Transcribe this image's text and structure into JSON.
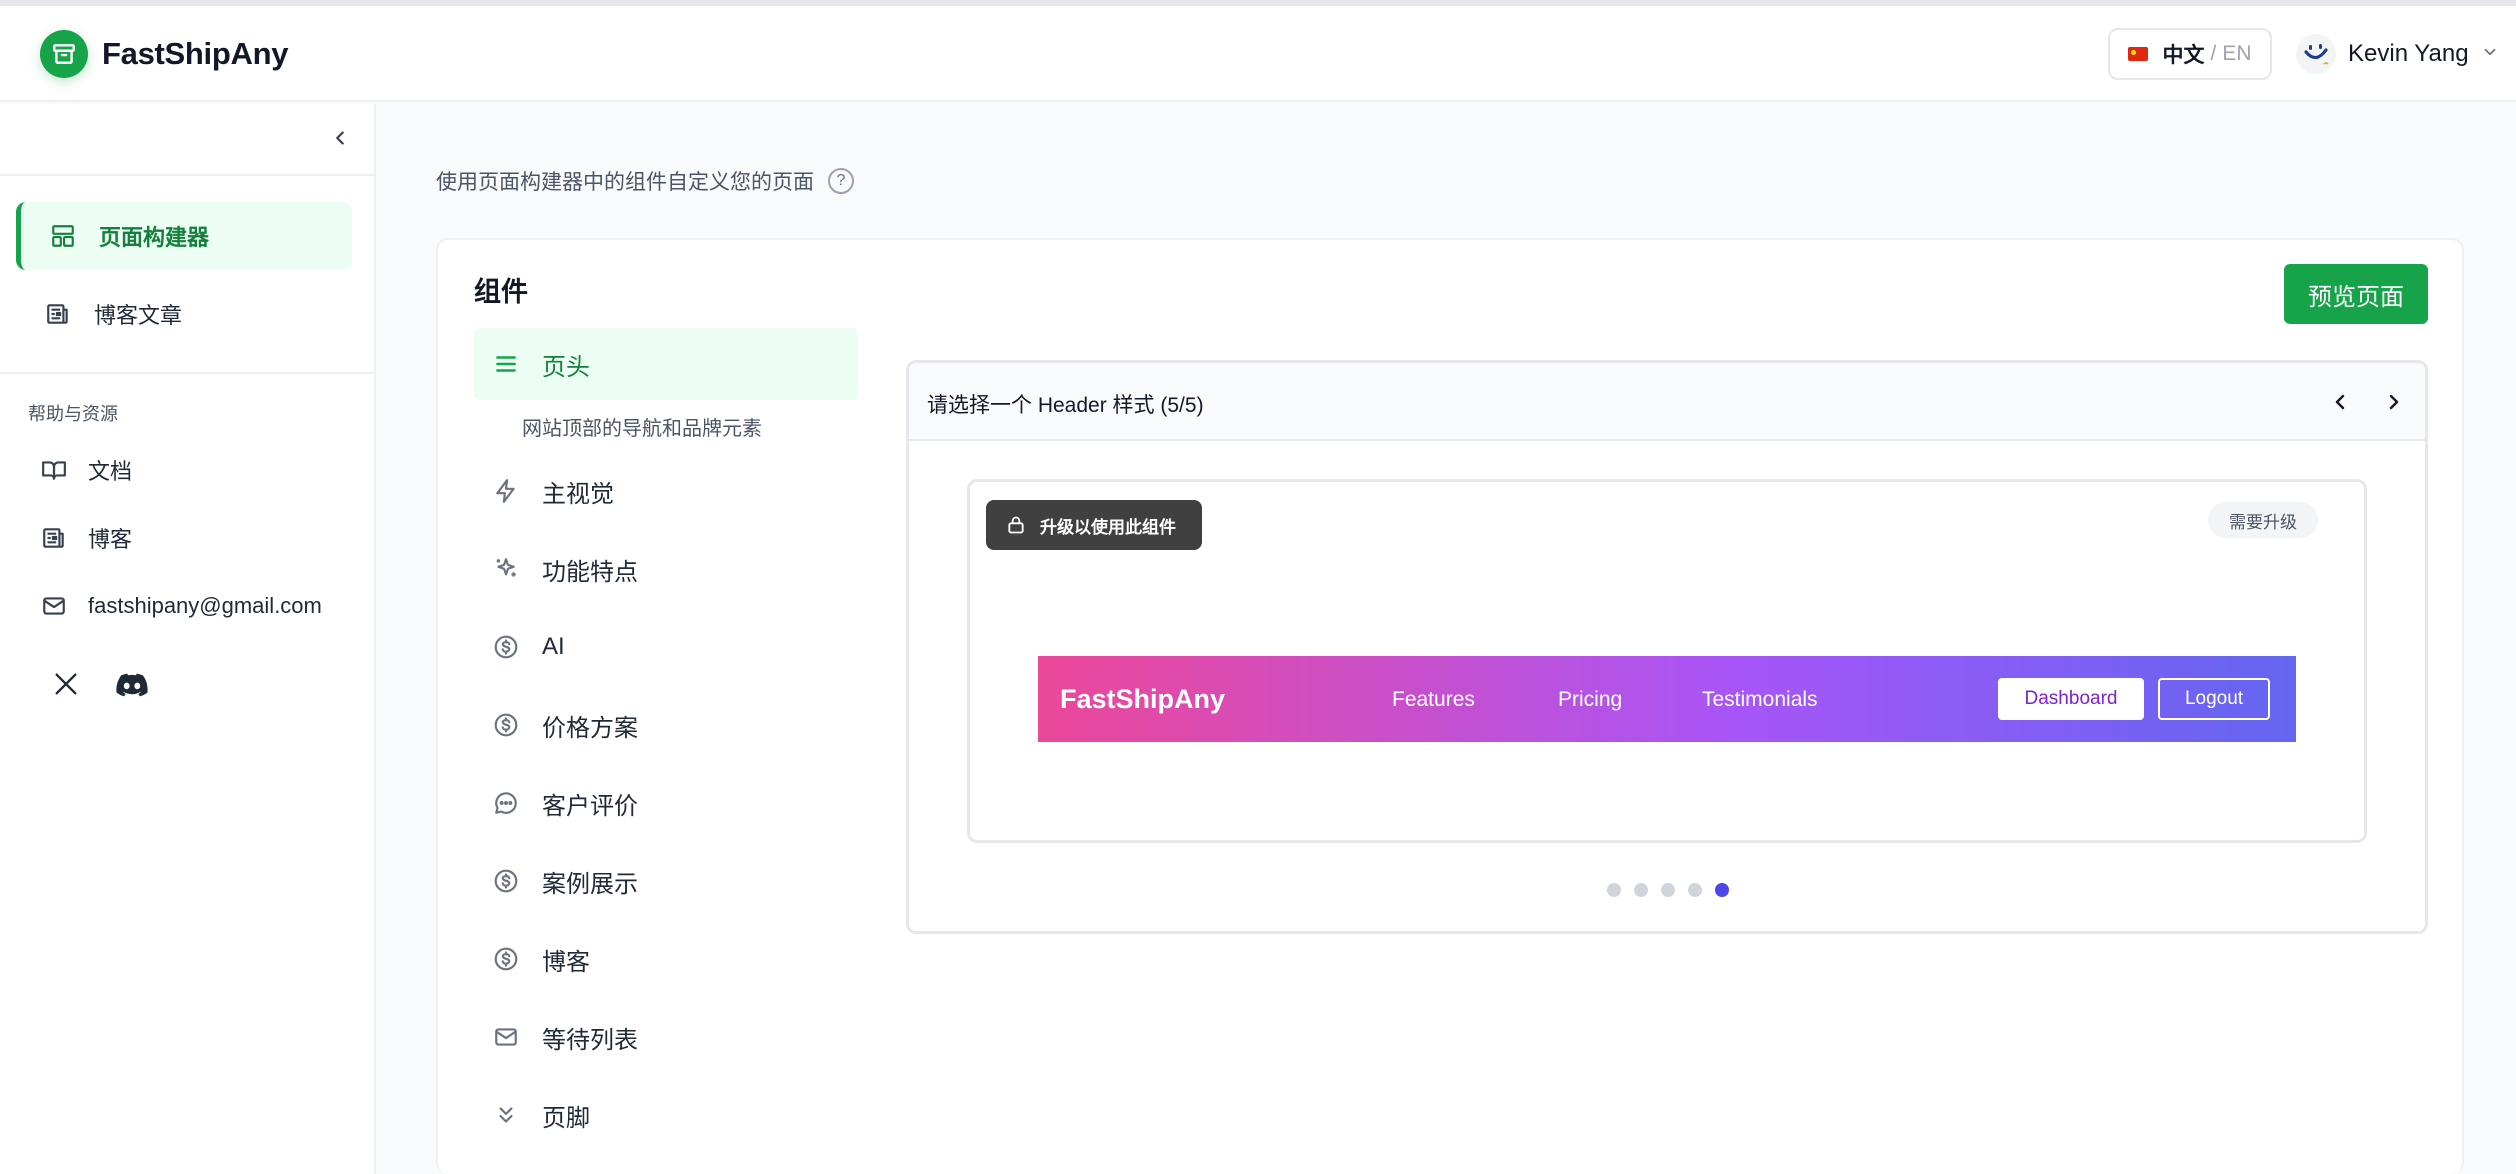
{
  "app": {
    "name": "FastShipAny"
  },
  "header": {
    "lang_zh": "中文",
    "lang_sep": "/",
    "lang_en": "EN",
    "user_name": "Kevin Yang"
  },
  "sidebar": {
    "items": [
      {
        "label": "页面构建器"
      },
      {
        "label": "博客文章"
      }
    ],
    "section_title": "帮助与资源",
    "resources": [
      {
        "label": "文档"
      },
      {
        "label": "博客"
      },
      {
        "label": "fastshipany@gmail.com"
      }
    ]
  },
  "main": {
    "intro": "使用页面构建器中的组件自定义您的页面",
    "help": "?",
    "card_title": "组件",
    "preview_label": "预览页面",
    "components": [
      {
        "label": "页头",
        "description": "网站顶部的导航和品牌元素"
      },
      {
        "label": "主视觉"
      },
      {
        "label": "功能特点"
      },
      {
        "label": "AI"
      },
      {
        "label": "价格方案"
      },
      {
        "label": "客户评价"
      },
      {
        "label": "案例展示"
      },
      {
        "label": "博客"
      },
      {
        "label": "等待列表"
      },
      {
        "label": "页脚"
      }
    ],
    "selector": {
      "title": "请选择一个 Header 样式 (5/5)",
      "upgrade_badge": "升级以使用此组件",
      "need_upgrade": "需要升级",
      "preview": {
        "logo": "FastShipAny",
        "nav": [
          "Features",
          "Pricing",
          "Testimonials"
        ],
        "dashboard": "Dashboard",
        "logout": "Logout"
      },
      "total_styles": 5,
      "current_style": 5
    }
  },
  "colors": {
    "accent": "#16a34a",
    "accent_bg": "#ecfdf3",
    "dot_active": "#4f46e5",
    "gradient": [
      "#ec4899",
      "#a855f7",
      "#6366f1"
    ]
  }
}
